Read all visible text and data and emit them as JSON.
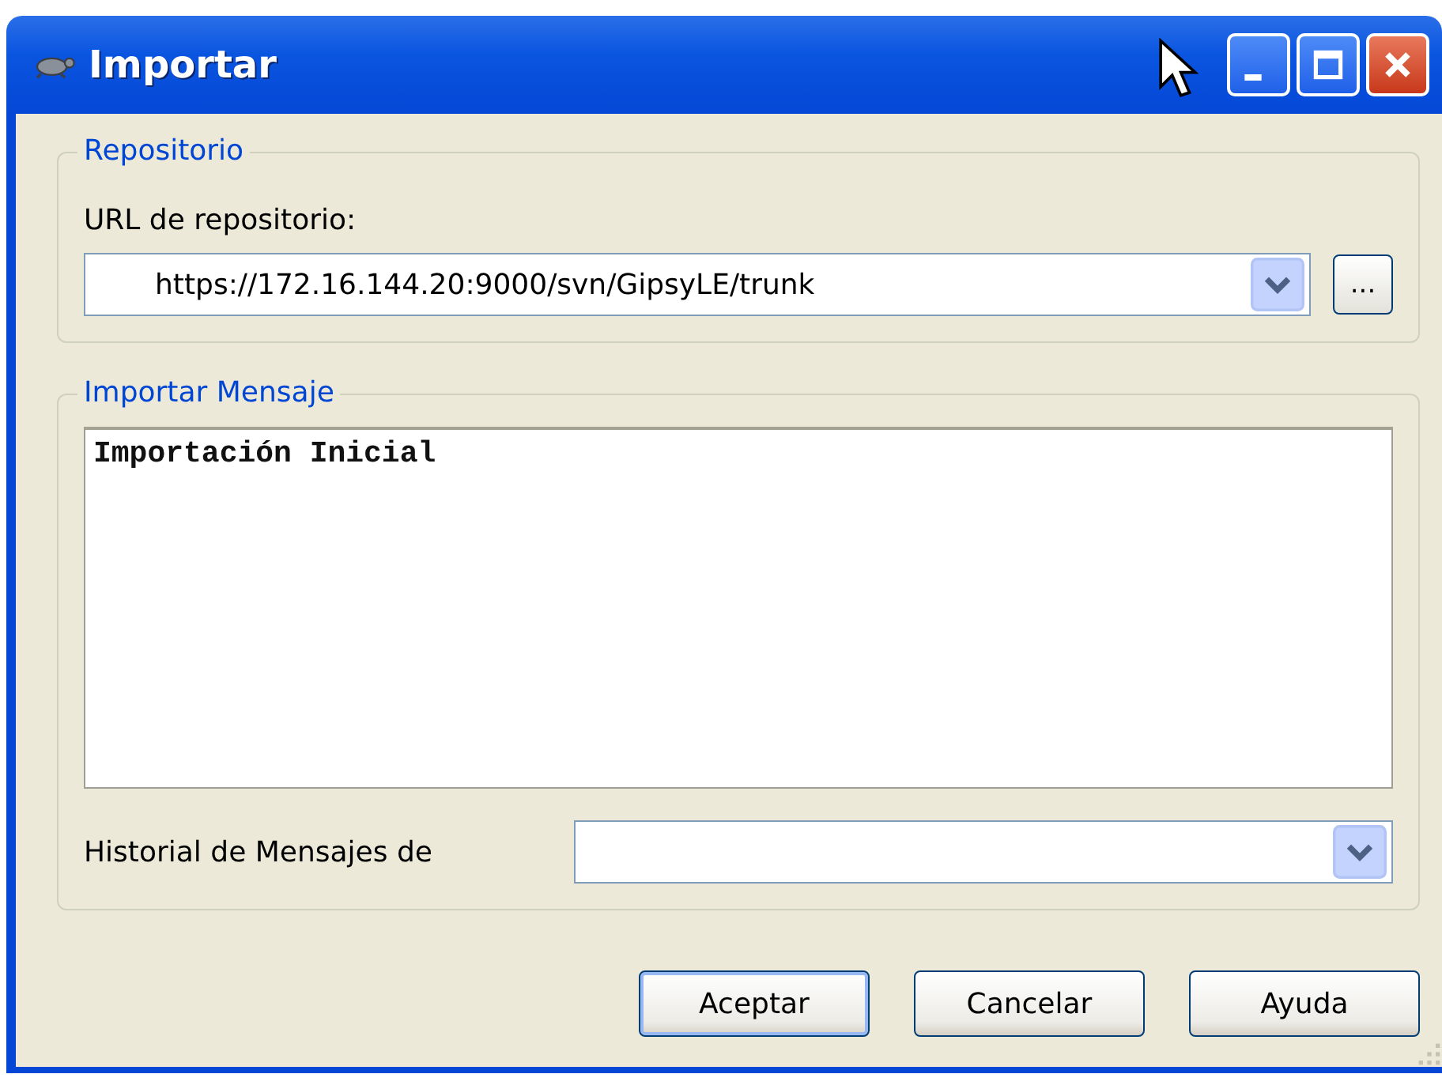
{
  "window": {
    "title": "Importar"
  },
  "repository": {
    "legend": "Repositorio",
    "url_label": "URL de repositorio:",
    "url_value": "https://172.16.144.20:9000/svn/GipsyLE/trunk",
    "browse_button": "..."
  },
  "message": {
    "legend": "Importar Mensaje",
    "text": "Importación Inicial",
    "history_label": "Historial de Mensajes de"
  },
  "buttons": [
    {
      "label": "Aceptar",
      "default": true
    },
    {
      "label": "Cancelar",
      "default": false
    },
    {
      "label": "Ayuda",
      "default": false
    }
  ]
}
